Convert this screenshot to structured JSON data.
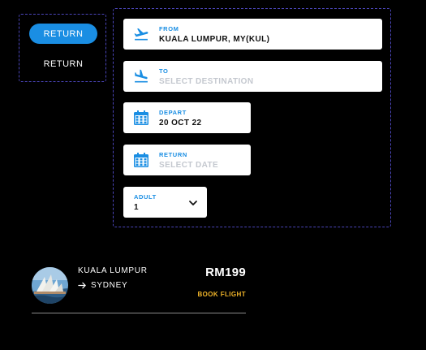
{
  "colors": {
    "accent": "#1a8ee3",
    "book_link": "#f0b429",
    "dashed_border": "#4a45b8",
    "placeholder": "#c4c8cf"
  },
  "trip_type": {
    "options": [
      {
        "label": "RETURN",
        "active": true
      },
      {
        "label": "RETURN",
        "active": false
      }
    ]
  },
  "form": {
    "from": {
      "label": "FROM",
      "value": "KUALA LUMPUR, MY(KUL)",
      "icon": "plane-takeoff-icon"
    },
    "to": {
      "label": "TO",
      "placeholder": "SELECT DESTINATION",
      "icon": "plane-landing-icon"
    },
    "depart": {
      "label": "DEPART",
      "value": "20 OCT 22",
      "icon": "calendar-icon"
    },
    "return": {
      "label": "RETURN",
      "placeholder": "SELECT DATE",
      "icon": "calendar-icon"
    },
    "adult": {
      "label": "ADULT",
      "value": "1",
      "icon": "chevron-down-icon"
    }
  },
  "result": {
    "origin": "KUALA LUMPUR",
    "destination": "SYDNEY",
    "price": "RM199",
    "book_label": "BOOK FLIGHT",
    "image": "sydney-opera-house-thumbnail",
    "arrow_icon": "arrow-right-icon"
  }
}
